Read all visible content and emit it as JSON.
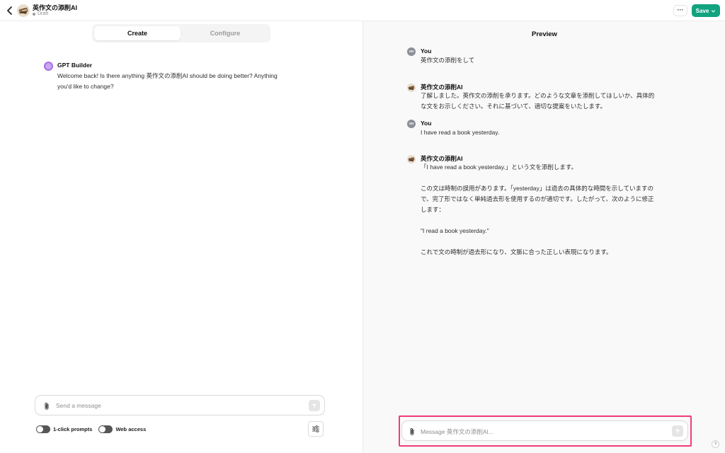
{
  "header": {
    "title": "英作文の添削AI",
    "status": "Draft",
    "more_label": "···",
    "save_label": "Save"
  },
  "tabs": [
    {
      "label": "Create",
      "active": true
    },
    {
      "label": "Configure",
      "active": false
    }
  ],
  "builder": {
    "name": "GPT Builder",
    "message": "Welcome back! Is there anything 英作文の添削AI should be doing better? Anything you'd like to change?"
  },
  "left_composer": {
    "placeholder": "Send a message"
  },
  "toggles": [
    {
      "label": "1-click prompts"
    },
    {
      "label": "Web access"
    }
  ],
  "preview": {
    "title": "Preview",
    "messages": [
      {
        "role": "user",
        "avatar": "SH",
        "name": "You",
        "text": "英作文の添削をして"
      },
      {
        "role": "gpt",
        "name": "英作文の添削AI",
        "text": "了解しました。英作文の添削を承ります。どのような文章を添削してほしいか、具体的な文をお示しください。それに基づいて、適切な提案をいたします。"
      },
      {
        "role": "user",
        "avatar": "SH",
        "name": "You",
        "text": "I have read a book yesterday."
      },
      {
        "role": "gpt",
        "name": "英作文の添削AI",
        "paragraphs": [
          "「I have read a book yesterday.」という文を添削します。",
          "この文は時制の誤用があります。「yesterday」は過去の具体的な時間を示していますので、完了形ではなく単純過去形を使用するのが適切です。したがって、次のように修正します：",
          "\"I read a book yesterday.\"",
          "これで文の時制が過去形になり、文脈に合った正しい表現になります。"
        ]
      }
    ],
    "composer_placeholder": "Message 英作文の添削AI..."
  },
  "help_label": "?",
  "colors": {
    "save_green": "#10a37f",
    "highlight": "#ef3c7a",
    "builder_purple": "#a86ee8"
  }
}
